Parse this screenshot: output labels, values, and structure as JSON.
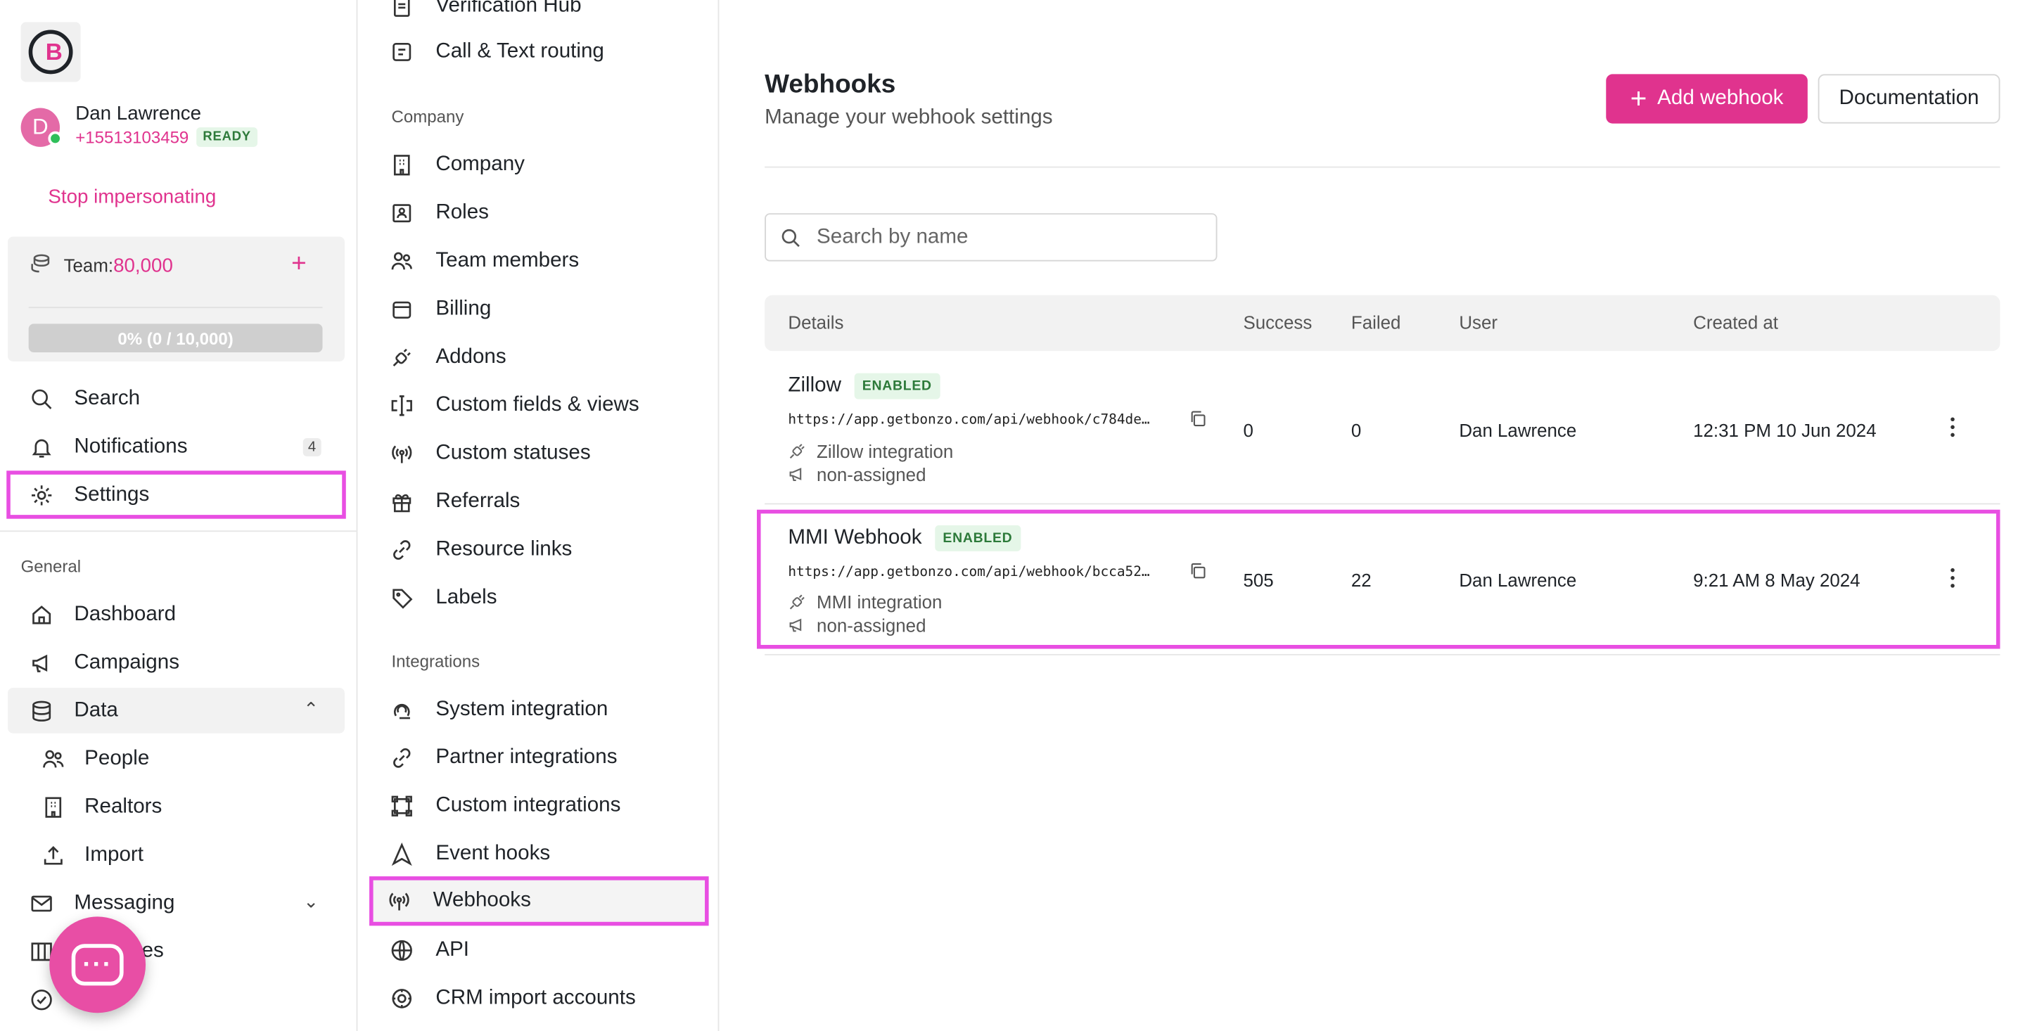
{
  "user": {
    "avatar_letter": "D",
    "name": "Dan Lawrence",
    "phone": "+15513103459",
    "status": "READY",
    "stop_impersonating": "Stop impersonating"
  },
  "team": {
    "label": "Team:",
    "credits": "80,000",
    "usage_text": "0% (0 / 10,000)",
    "usage_fraction": 0
  },
  "sidebar": {
    "top_items": [
      {
        "label": "Search",
        "icon": "search-icon"
      },
      {
        "label": "Notifications",
        "icon": "bell-icon",
        "badge": "4"
      },
      {
        "label": "Settings",
        "icon": "gear-icon"
      }
    ],
    "general_label": "General",
    "general_items": [
      {
        "label": "Dashboard",
        "icon": "home-icon"
      },
      {
        "label": "Campaigns",
        "icon": "megaphone-icon"
      },
      {
        "label": "Data",
        "icon": "database-icon"
      },
      {
        "label": "People",
        "icon": "people-icon"
      },
      {
        "label": "Realtors",
        "icon": "building-icon"
      },
      {
        "label": "Import",
        "icon": "upload-icon"
      },
      {
        "label": "Messaging",
        "icon": "mail-icon"
      },
      {
        "label": "es",
        "icon": "columns-icon"
      },
      {
        "label": "",
        "icon": "check-circle-icon"
      }
    ]
  },
  "settings_nav": {
    "top_items": [
      {
        "label": "Verification Hub",
        "icon": "clipboard-icon"
      },
      {
        "label": "Call & Text routing",
        "icon": "phone-route-icon"
      }
    ],
    "company_label": "Company",
    "company_items": [
      {
        "label": "Company",
        "icon": "building-icon"
      },
      {
        "label": "Roles",
        "icon": "id-card-icon"
      },
      {
        "label": "Team members",
        "icon": "people-icon"
      },
      {
        "label": "Billing",
        "icon": "wallet-icon"
      },
      {
        "label": "Addons",
        "icon": "plug-icon"
      },
      {
        "label": "Custom fields & views",
        "icon": "text-cursor-icon"
      },
      {
        "label": "Custom statuses",
        "icon": "broadcast-icon"
      },
      {
        "label": "Referrals",
        "icon": "gift-icon"
      },
      {
        "label": "Resource links",
        "icon": "link-icon"
      },
      {
        "label": "Labels",
        "icon": "tag-icon"
      }
    ],
    "integrations_label": "Integrations",
    "integration_items": [
      {
        "label": "System integration",
        "icon": "system-icon"
      },
      {
        "label": "Partner integrations",
        "icon": "link-icon"
      },
      {
        "label": "Custom integrations",
        "icon": "frame-icon"
      },
      {
        "label": "Event hooks",
        "icon": "navigation-icon"
      },
      {
        "label": "Webhooks",
        "icon": "broadcast-icon"
      },
      {
        "label": "API",
        "icon": "globe-icon"
      },
      {
        "label": "CRM import accounts",
        "icon": "settings-cog-icon"
      }
    ]
  },
  "main": {
    "title": "Webhooks",
    "subtitle": "Manage your webhook settings",
    "add_button": "Add webhook",
    "doc_button": "Documentation",
    "search_placeholder": "Search by name",
    "columns": [
      "Details",
      "Success",
      "Failed",
      "User",
      "Created at"
    ],
    "rows": [
      {
        "name": "Zillow",
        "status": "ENABLED",
        "url": "https://app.getbonzo.com/api/webhook/c784de…",
        "integration": "Zillow integration",
        "assignment": "non-assigned",
        "success": "0",
        "failed": "0",
        "user": "Dan Lawrence",
        "created": "12:31 PM 10 Jun 2024"
      },
      {
        "name": "MMI Webhook",
        "status": "ENABLED",
        "url": "https://app.getbonzo.com/api/webhook/bcca52…",
        "integration": "MMI integration",
        "assignment": "non-assigned",
        "success": "505",
        "failed": "22",
        "user": "Dan Lawrence",
        "created": "9:21 AM 8 May 2024"
      }
    ]
  },
  "colors": {
    "brand_pink": "#e0338e",
    "highlight_outline": "#e84ee2",
    "enabled_green": "#2d7a3a"
  }
}
